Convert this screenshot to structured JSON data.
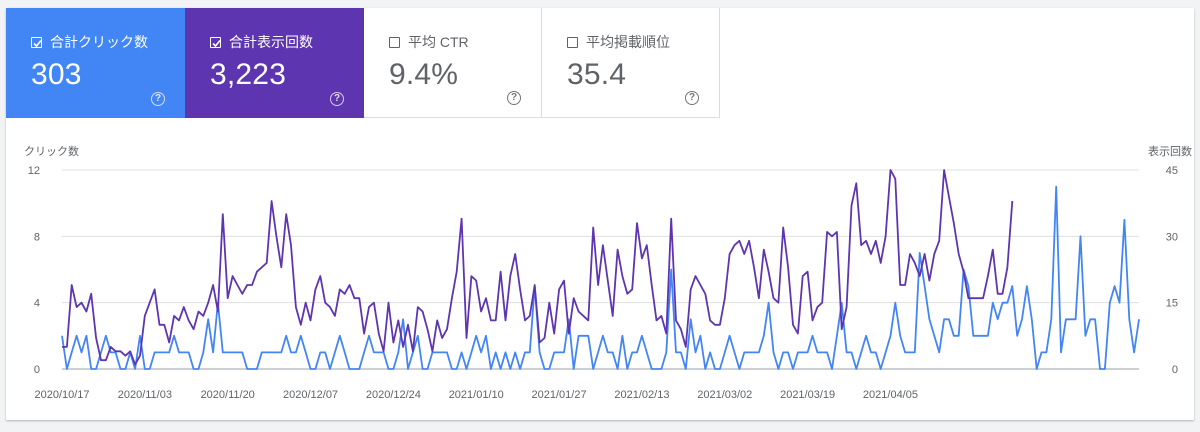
{
  "metrics": [
    {
      "label": "合計クリック数",
      "value": "303",
      "checked": true,
      "color": "#4285f4"
    },
    {
      "label": "合計表示回数",
      "value": "3,223",
      "checked": true,
      "color": "#5e35b1"
    },
    {
      "label": "平均 CTR",
      "value": "9.4%",
      "checked": false
    },
    {
      "label": "平均掲載順位",
      "value": "35.4",
      "checked": false
    }
  ],
  "help_icon": "?",
  "chart_data": {
    "type": "line",
    "x_labels": [
      "2020/10/17",
      "2020/11/03",
      "2020/11/20",
      "2020/12/07",
      "2020/12/24",
      "2021/01/10",
      "2021/01/27",
      "2021/02/13",
      "2021/03/02",
      "2021/03/19",
      "2021/04/05"
    ],
    "x_start": "2020/10/17",
    "left_axis": {
      "label": "クリック数",
      "ticks": [
        "12",
        "8",
        "4",
        "0"
      ],
      "range": [
        0,
        12
      ]
    },
    "right_axis": {
      "label": "表示回数",
      "ticks": [
        "45",
        "30",
        "15",
        "0"
      ],
      "range": [
        0,
        45
      ]
    },
    "grid": true,
    "series": [
      {
        "name": "合計クリック数",
        "axis": "left",
        "color": "#4285f4",
        "values": [
          2,
          0,
          1,
          2,
          1,
          2,
          0,
          0,
          1,
          2,
          1,
          1,
          0,
          0,
          1,
          0,
          2,
          0,
          0,
          1,
          1,
          1,
          1,
          2,
          1,
          1,
          1,
          0,
          0,
          1,
          3,
          1,
          4,
          1,
          1,
          1,
          1,
          1,
          0,
          0,
          0,
          1,
          1,
          1,
          1,
          1,
          2,
          1,
          1,
          2,
          1,
          0,
          0,
          1,
          1,
          0,
          1,
          2,
          1,
          0,
          0,
          0,
          1,
          2,
          1,
          1,
          1,
          0,
          0,
          1,
          3,
          0,
          1,
          2,
          0,
          0,
          1,
          1,
          1,
          1,
          0,
          0,
          1,
          0,
          1,
          2,
          1,
          2,
          0,
          1,
          0,
          1,
          0,
          1,
          0,
          1,
          1,
          5,
          1,
          0,
          0,
          1,
          1,
          1,
          3,
          0,
          2,
          2,
          2,
          0,
          1,
          2,
          1,
          1,
          0,
          2,
          0,
          1,
          1,
          2,
          1,
          0,
          0,
          0,
          1,
          6,
          1,
          1,
          0,
          3,
          1,
          2,
          0,
          1,
          0,
          0,
          1,
          2,
          1,
          0,
          1,
          1,
          1,
          1,
          2,
          4,
          1,
          0,
          1,
          1,
          0,
          1,
          1,
          1,
          2,
          1,
          1,
          1,
          0,
          2,
          4,
          1,
          1,
          0,
          1,
          2,
          1,
          1,
          0,
          1,
          2,
          4,
          2,
          1,
          1,
          1,
          7,
          5,
          3,
          2,
          1,
          3,
          3,
          2,
          2,
          6,
          5,
          2,
          2,
          2,
          2,
          4,
          3,
          4,
          4,
          5,
          2,
          3,
          5,
          3,
          0,
          1,
          1,
          3,
          11,
          1,
          3,
          3,
          3,
          8,
          2,
          3,
          3,
          0,
          0,
          4,
          5,
          4,
          9,
          3,
          1,
          3
        ]
      },
      {
        "name": "合計表示回数",
        "axis": "right",
        "color": "#5e35b1",
        "values": [
          5,
          5,
          19,
          14,
          15,
          13,
          17,
          7,
          2,
          2,
          5,
          4,
          4,
          3,
          4,
          1,
          3,
          12,
          15,
          18,
          10,
          10,
          6,
          12,
          11,
          14,
          11,
          9,
          13,
          12,
          15,
          19,
          13,
          35,
          16,
          21,
          19,
          17,
          19,
          19,
          22,
          23,
          24,
          38,
          30,
          23,
          35,
          28,
          14,
          10,
          15,
          11,
          18,
          21,
          15,
          14,
          12,
          18,
          17,
          19,
          16,
          16,
          8,
          14,
          15,
          8,
          4,
          15,
          6,
          11,
          5,
          10,
          4,
          14,
          13,
          9,
          4,
          11,
          7,
          9,
          16,
          22,
          34,
          7,
          21,
          20,
          13,
          16,
          11,
          11,
          22,
          11,
          21,
          26,
          18,
          11,
          12,
          19,
          6,
          7,
          15,
          8,
          18,
          20,
          8,
          16,
          13,
          12,
          11,
          32,
          19,
          28,
          20,
          12,
          27,
          21,
          17,
          18,
          33,
          25,
          28,
          19,
          11,
          12,
          8,
          34,
          11,
          9,
          5,
          18,
          21,
          19,
          17,
          11,
          10,
          10,
          16,
          26,
          28,
          29,
          26,
          29,
          23,
          16,
          27,
          22,
          16,
          15,
          32,
          23,
          10,
          8,
          21,
          22,
          11,
          14,
          15,
          31,
          30,
          31,
          9,
          14,
          37,
          42,
          28,
          29,
          26,
          29,
          24,
          30,
          45,
          43,
          19,
          19,
          26,
          24,
          21,
          26,
          20,
          26,
          29,
          45,
          39,
          33,
          26,
          22,
          16,
          16,
          16,
          16,
          21,
          27,
          17,
          17,
          23,
          38
        ]
      }
    ]
  }
}
